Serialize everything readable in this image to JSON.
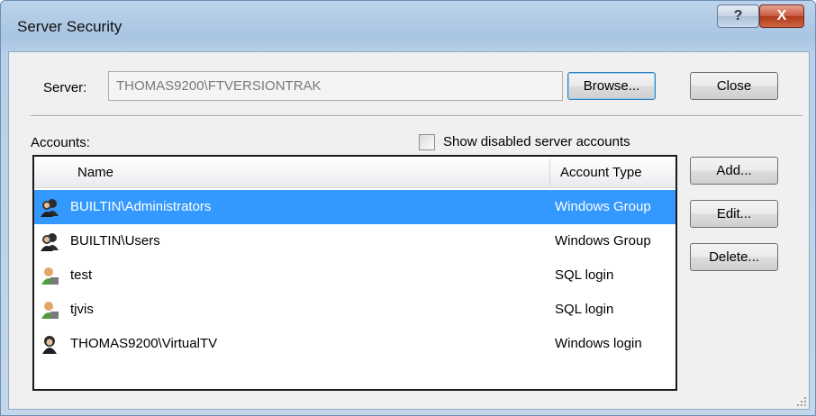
{
  "window": {
    "title": "Server Security",
    "help_glyph": "?",
    "close_glyph": "X"
  },
  "server": {
    "label": "Server:",
    "value": "THOMAS9200\\FTVERSIONTRAK"
  },
  "buttons": {
    "browse": "Browse...",
    "close": "Close",
    "add": "Add...",
    "edit": "Edit...",
    "delete": "Delete..."
  },
  "accounts": {
    "label": "Accounts:",
    "show_disabled_label": "Show disabled server accounts",
    "show_disabled_checked": false,
    "columns": {
      "name": "Name",
      "type": "Account Type"
    },
    "rows": [
      {
        "name": "BUILTIN\\Administrators",
        "type": "Windows Group",
        "icon": "windows-group-icon",
        "selected": true
      },
      {
        "name": "BUILTIN\\Users",
        "type": "Windows Group",
        "icon": "windows-group-icon",
        "selected": false
      },
      {
        "name": "test",
        "type": "SQL login",
        "icon": "sql-login-icon",
        "selected": false
      },
      {
        "name": "tjvis",
        "type": "SQL login",
        "icon": "sql-login-icon",
        "selected": false
      },
      {
        "name": "THOMAS9200\\VirtualTV",
        "type": "Windows login",
        "icon": "windows-login-icon",
        "selected": false
      }
    ]
  },
  "colors": {
    "selection": "#3399ff",
    "title_gradient": "#a9c5e2"
  }
}
